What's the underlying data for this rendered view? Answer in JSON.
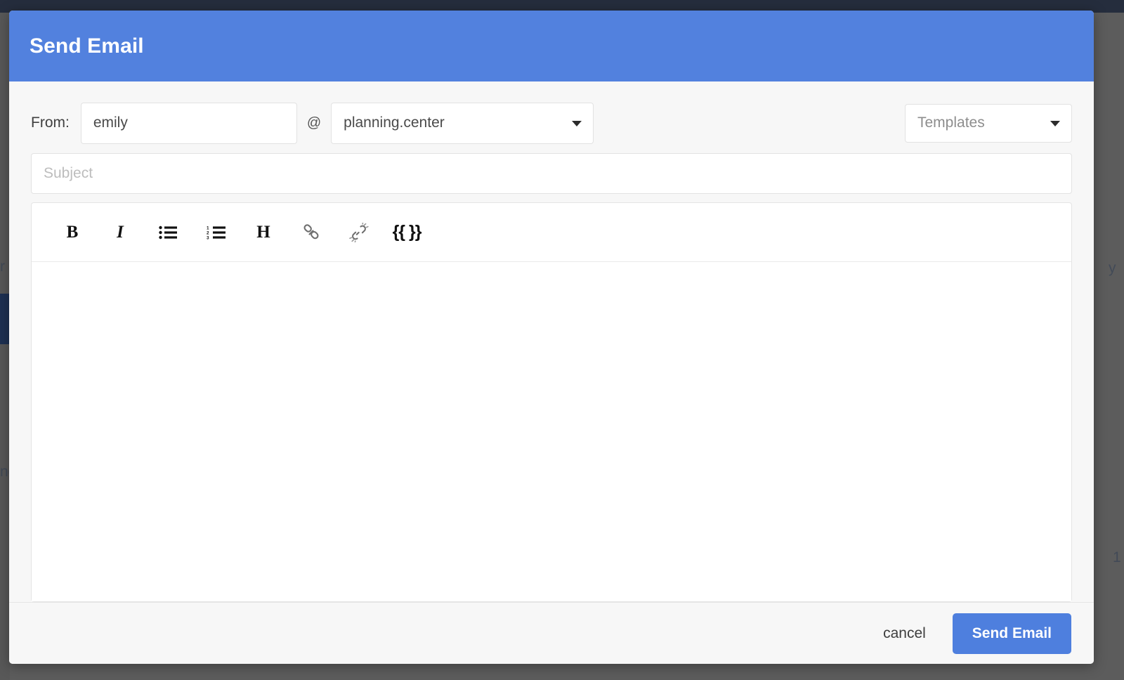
{
  "backdrop": {
    "ghost_text_left_top": "r",
    "ghost_text_left_mid": "nc",
    "ghost_text_right_top": "y",
    "ghost_text_right_bottom": "1"
  },
  "modal": {
    "title": "Send Email",
    "from": {
      "label": "From:",
      "username_value": "emily",
      "at_separator": "@",
      "domain_value": "planning.center",
      "domain_options": [
        "planning.center"
      ]
    },
    "templates": {
      "selected": "Templates",
      "options": [
        "Templates"
      ]
    },
    "subject": {
      "value": "",
      "placeholder": "Subject"
    },
    "editor": {
      "body_value": "",
      "toolbar": [
        {
          "name": "bold",
          "glyph": "B"
        },
        {
          "name": "italic",
          "glyph": "I"
        },
        {
          "name": "bulleted-list",
          "glyph": ""
        },
        {
          "name": "numbered-list",
          "glyph": ""
        },
        {
          "name": "heading",
          "glyph": "H"
        },
        {
          "name": "link",
          "glyph": ""
        },
        {
          "name": "unlink",
          "glyph": ""
        },
        {
          "name": "merge-field",
          "glyph": "{{ }}"
        }
      ]
    },
    "footer": {
      "cancel_label": "cancel",
      "send_label": "Send Email"
    }
  },
  "colors": {
    "header_blue": "#5281de",
    "button_blue": "#4e7fde",
    "modal_bg": "#f7f7f7",
    "field_bg": "#ffffff",
    "placeholder_gray": "#bdbdbd"
  }
}
